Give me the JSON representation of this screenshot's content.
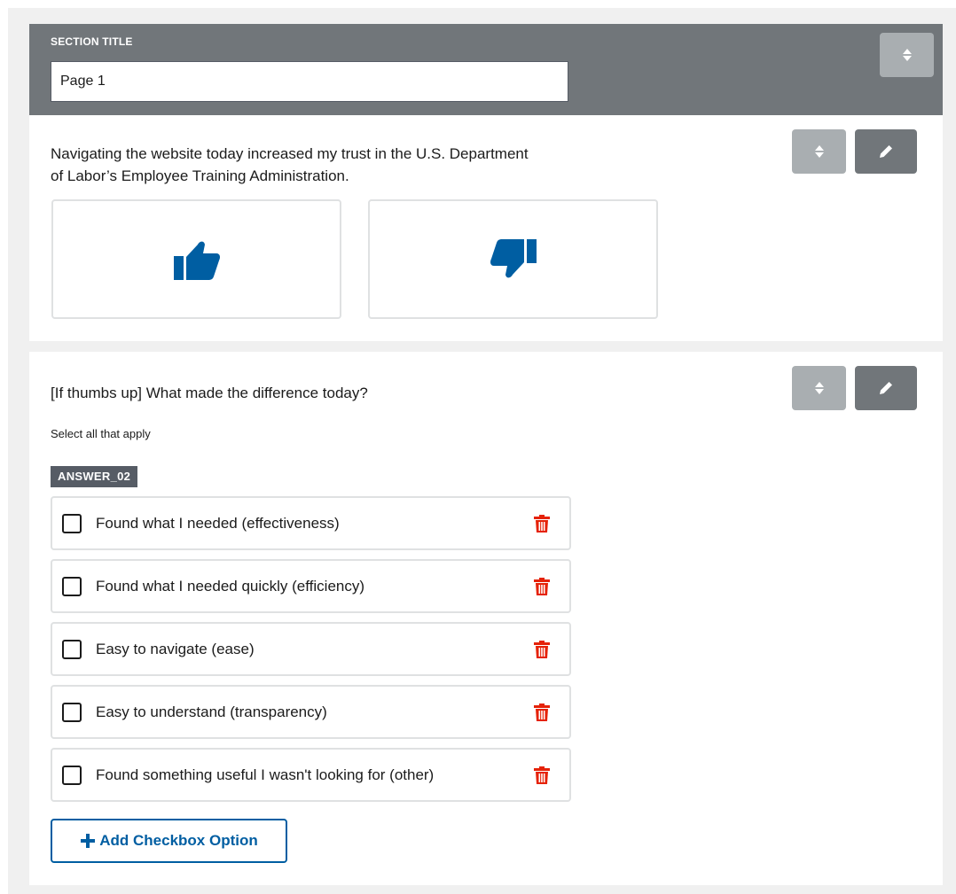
{
  "section": {
    "title_label": "SECTION TITLE",
    "title_value": "Page 1"
  },
  "question1": {
    "text": "Navigating the website today increased my trust in the U.S. Department of Labor’s Employee Training Administration.",
    "thumbs_up_icon": "thumbs-up-icon",
    "thumbs_down_icon": "thumbs-down-icon"
  },
  "question2": {
    "text": "[If thumbs up] What made the difference today?",
    "helper": "Select all that apply",
    "answer_tag": "ANSWER_02",
    "options": [
      {
        "label": "Found what I needed (effectiveness)",
        "checked": false
      },
      {
        "label": "Found what I needed quickly (efficiency)",
        "checked": false
      },
      {
        "label": "Easy to navigate (ease)",
        "checked": false
      },
      {
        "label": "Easy to understand (transparency)",
        "checked": false
      },
      {
        "label": "Found something useful I wasn't looking for (other)",
        "checked": false
      }
    ],
    "add_button_label": "Add Checkbox Option"
  },
  "colors": {
    "primary": "#005ea2",
    "header_gray": "#71767a",
    "light_button": "#a9aeb1",
    "delete_red": "#e52207"
  }
}
